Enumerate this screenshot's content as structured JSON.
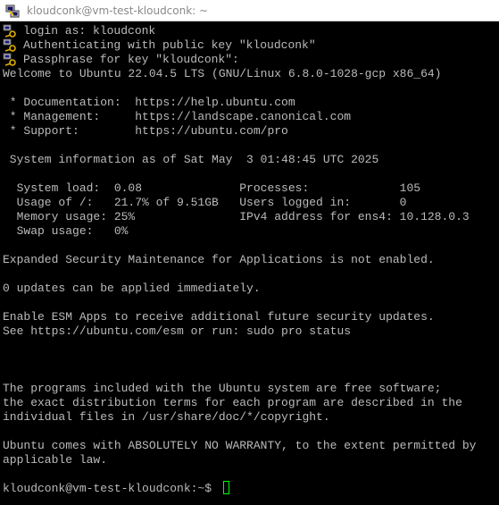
{
  "window": {
    "title": "kloudconk@vm-test-kloudconk: ~",
    "icon": "putty-terminal-icon"
  },
  "terminal": {
    "lines": [
      "login as: kloudconk",
      "Authenticating with public key \"kloudconk\"",
      "Passphrase for key \"kloudconk\":",
      "Welcome to Ubuntu 22.04.5 LTS (GNU/Linux 6.8.0-1028-gcp x86_64)",
      " * Documentation:  https://help.ubuntu.com",
      " * Management:     https://landscape.canonical.com",
      " * Support:        https://ubuntu.com/pro",
      " System information as of Sat May  3 01:48:45 UTC 2025",
      "  System load:  0.08              Processes:             105",
      "  Usage of /:   21.7% of 9.51GB   Users logged in:       0",
      "  Memory usage: 25%               IPv4 address for ens4: 10.128.0.3",
      "  Swap usage:   0%",
      "Expanded Security Maintenance for Applications is not enabled.",
      "0 updates can be applied immediately.",
      "Enable ESM Apps to receive additional future security updates.",
      "See https://ubuntu.com/esm or run: sudo pro status",
      "The programs included with the Ubuntu system are free software;",
      "the exact distribution terms for each program are described in the",
      "individual files in /usr/share/doc/*/copyright.",
      "Ubuntu comes with ABSOLUTELY NO WARRANTY, to the extent permitted by",
      "applicable law.",
      "kloudconk@vm-test-kloudconk:~$ "
    ]
  },
  "colors": {
    "background": "#000000",
    "text": "#bbbbbb",
    "cursor": "#00ff00",
    "titlebar": "#ffffff",
    "title_text": "#8a8a8a"
  }
}
